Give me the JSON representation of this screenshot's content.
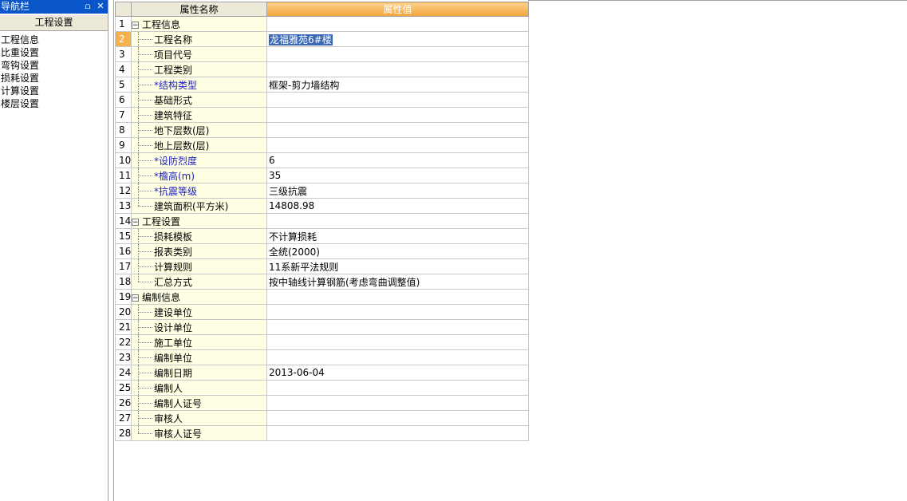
{
  "nav": {
    "title": "导航栏",
    "pin_icon": "pin-icon",
    "close_icon": "close-icon",
    "tab": "工程设置",
    "items": [
      "工程信息",
      "比重设置",
      "弯钩设置",
      "损耗设置",
      "计算设置",
      "楼层设置"
    ]
  },
  "grid": {
    "header_name": "属性名称",
    "header_value": "属性值",
    "rows": [
      {
        "num": "1",
        "name": "工程信息",
        "value": ""
      },
      {
        "num": "2",
        "name": "工程名称",
        "value": "龙福雅苑6#楼"
      },
      {
        "num": "3",
        "name": "项目代号",
        "value": ""
      },
      {
        "num": "4",
        "name": "工程类别",
        "value": ""
      },
      {
        "num": "5",
        "name": "*结构类型",
        "value": "框架-剪力墙结构"
      },
      {
        "num": "6",
        "name": "基础形式",
        "value": ""
      },
      {
        "num": "7",
        "name": "建筑特征",
        "value": ""
      },
      {
        "num": "8",
        "name": "地下层数(层)",
        "value": ""
      },
      {
        "num": "9",
        "name": "地上层数(层)",
        "value": ""
      },
      {
        "num": "10",
        "name": "*设防烈度",
        "value": "6"
      },
      {
        "num": "11",
        "name": "*檐高(m)",
        "value": "35"
      },
      {
        "num": "12",
        "name": "*抗震等级",
        "value": "三级抗震"
      },
      {
        "num": "13",
        "name": "建筑面积(平方米)",
        "value": "14808.98"
      },
      {
        "num": "14",
        "name": "工程设置",
        "value": ""
      },
      {
        "num": "15",
        "name": "损耗模板",
        "value": "不计算损耗"
      },
      {
        "num": "16",
        "name": "报表类别",
        "value": "全统(2000)"
      },
      {
        "num": "17",
        "name": "计算规则",
        "value": "11系新平法规则"
      },
      {
        "num": "18",
        "name": "汇总方式",
        "value": "按中轴线计算钢筋(考虑弯曲调整值)"
      },
      {
        "num": "19",
        "name": "编制信息",
        "value": ""
      },
      {
        "num": "20",
        "name": "建设单位",
        "value": ""
      },
      {
        "num": "21",
        "name": "设计单位",
        "value": ""
      },
      {
        "num": "22",
        "name": "施工单位",
        "value": ""
      },
      {
        "num": "23",
        "name": "编制单位",
        "value": ""
      },
      {
        "num": "24",
        "name": "编制日期",
        "value": "2013-06-04"
      },
      {
        "num": "25",
        "name": "编制人",
        "value": ""
      },
      {
        "num": "26",
        "name": "编制人证号",
        "value": ""
      },
      {
        "num": "27",
        "name": "审核人",
        "value": ""
      },
      {
        "num": "28",
        "name": "审核人证号",
        "value": ""
      }
    ],
    "collapse_glyph": "−"
  }
}
